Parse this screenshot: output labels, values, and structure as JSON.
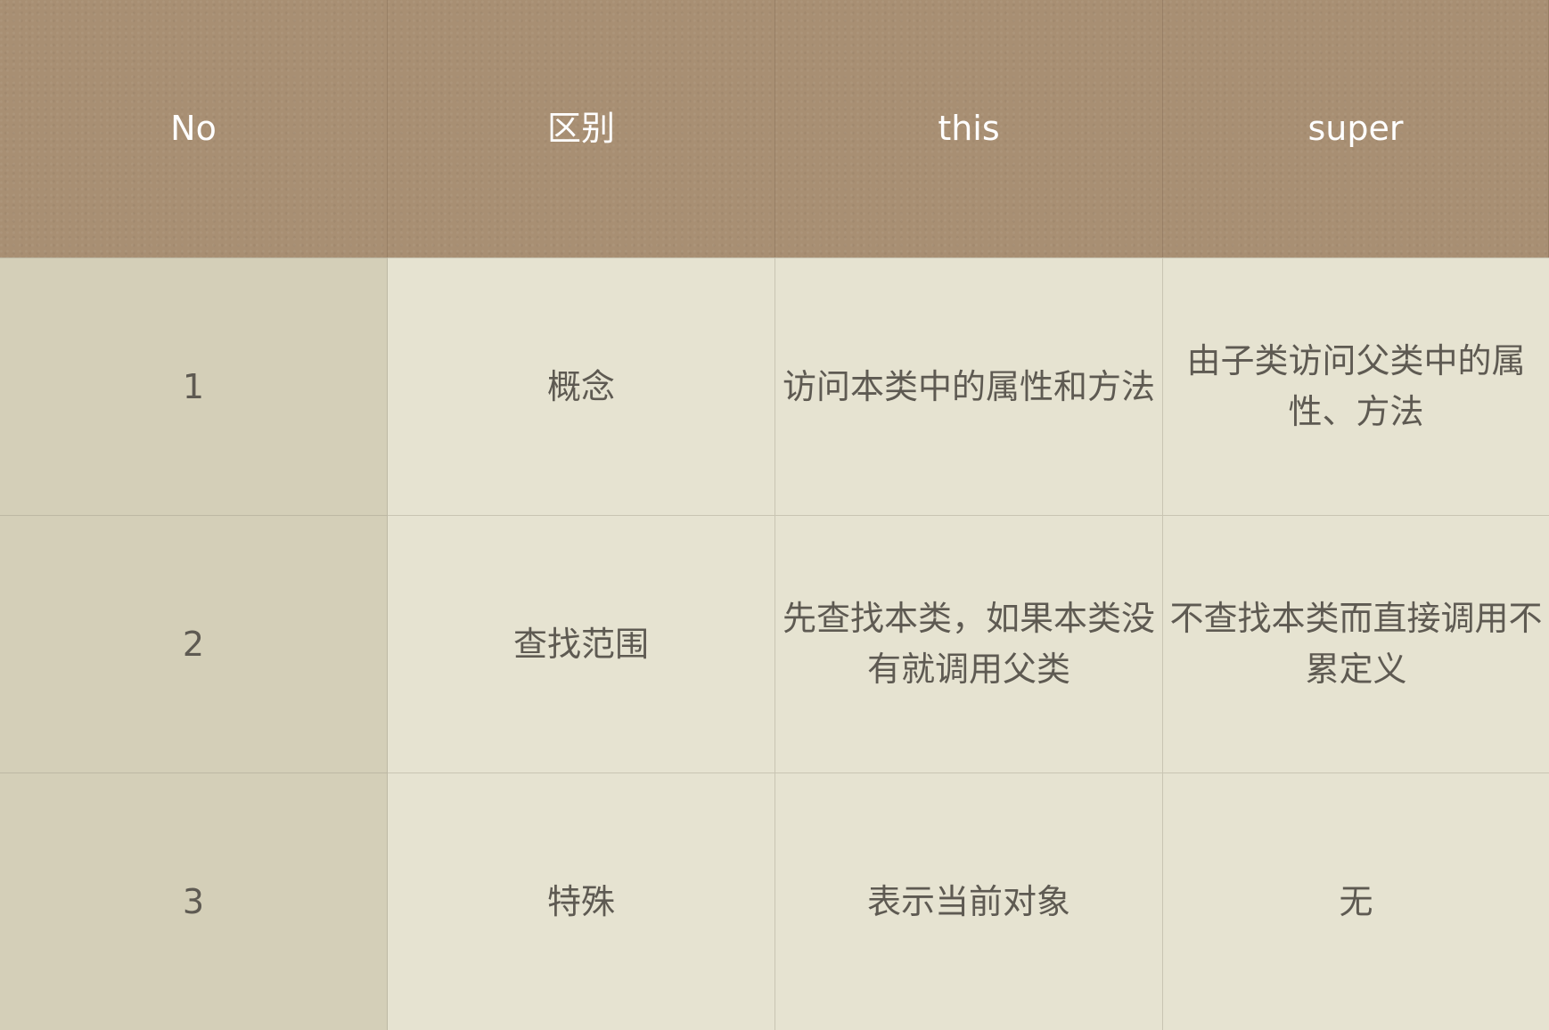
{
  "table": {
    "headers": [
      "No",
      "区别",
      "this",
      "super"
    ],
    "rows": [
      {
        "no": "1",
        "diff": "概念",
        "this": "访问本类中的属性和方法",
        "super": "由子类访问父类中的属性、方法"
      },
      {
        "no": "2",
        "diff": "查找范围",
        "this": "先查找本类，如果本类没有就调用父类",
        "super": "不查找本类而直接调用不累定义"
      },
      {
        "no": "3",
        "diff": "特殊",
        "this": "表示当前对象",
        "super": "无"
      }
    ]
  },
  "colors": {
    "header_bg": "#a88f73",
    "first_col_bg": "#d4cfb8",
    "body_bg": "#e6e3d1",
    "header_text": "#ffffff",
    "body_text": "#5e5a52"
  }
}
